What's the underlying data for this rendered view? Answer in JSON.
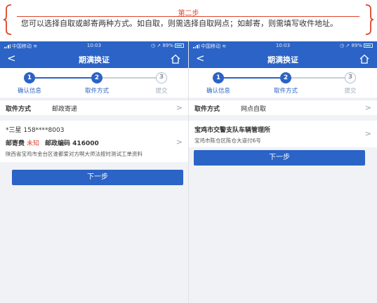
{
  "banner": {
    "title": "第二步",
    "text": "您可以选择自取或邮寄两种方式。如自取，则需选择自取网点；如邮寄，则需填写收件地址。"
  },
  "status": {
    "carrier": "中国移动",
    "time": "10:03",
    "battery": "89%"
  },
  "nav": {
    "back": "<",
    "title": "期满换证"
  },
  "steps": [
    {
      "num": "1",
      "label": "确认信息"
    },
    {
      "num": "2",
      "label": "取件方式"
    },
    {
      "num": "3",
      "label": "提交"
    }
  ],
  "left": {
    "method_key": "取件方式",
    "method_value": "邮政寄递",
    "recipient": "*三星   158****8003",
    "fee_label": "邮寄费",
    "fee_value": "未知",
    "postcode": "邮政编码 416000",
    "address": "陕西省宝鸡市金台区谁都爱对方啊大师法按时测试工单资料",
    "next_button": "下一步"
  },
  "right": {
    "method_key": "取件方式",
    "method_value": "网点自取",
    "pickup_name": "宝鸡市交警支队车辆管理所",
    "pickup_address": "宝鸡市陈仓区陈仓大道付6号",
    "next_button": "下一步"
  },
  "chevron": ">",
  "colors": {
    "primary": "#2b63c6",
    "accent": "#e0442e",
    "background": "#f1f2f5"
  }
}
